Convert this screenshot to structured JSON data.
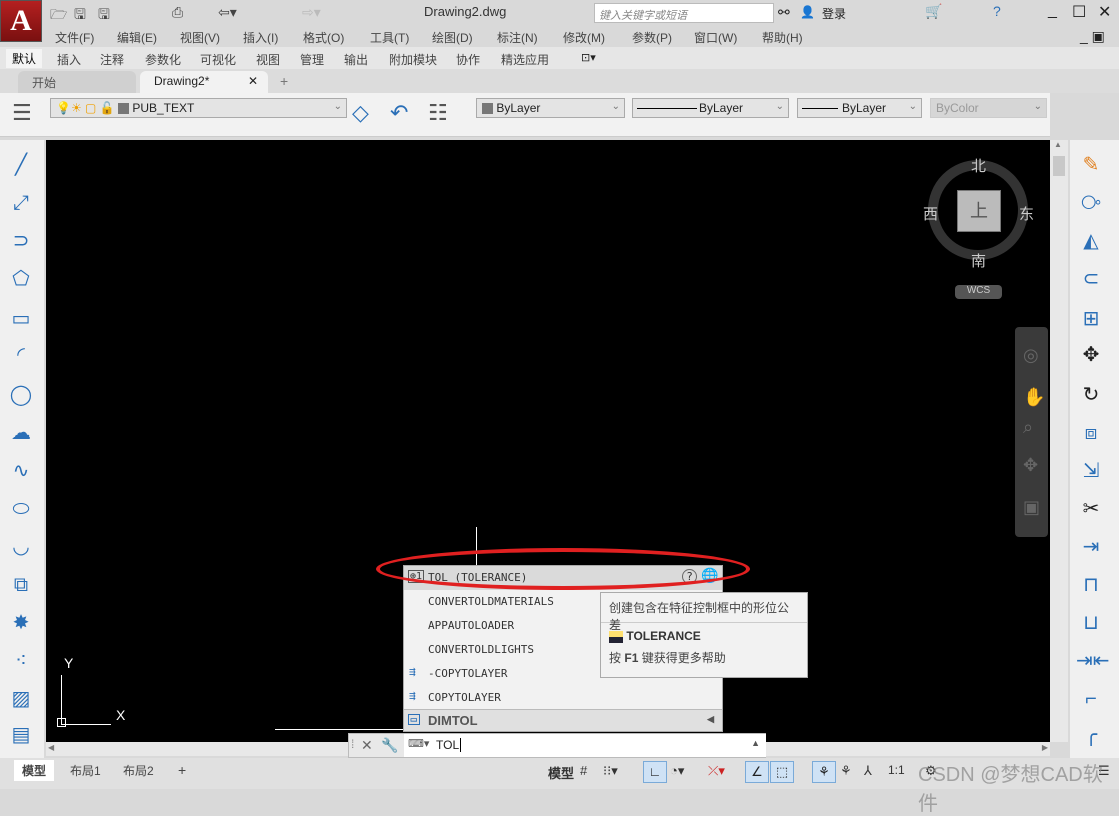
{
  "app": {
    "logo_letter": "A",
    "title": "Drawing2.dwg",
    "search_placeholder": "键入关键字或短语",
    "login": "登录"
  },
  "menu": [
    "文件(F)",
    "编辑(E)",
    "视图(V)",
    "插入(I)",
    "格式(O)",
    "工具(T)",
    "绘图(D)",
    "标注(N)",
    "修改(M)",
    "参数(P)",
    "窗口(W)",
    "帮助(H)"
  ],
  "ribbon_tabs": [
    "默认",
    "插入",
    "注释",
    "参数化",
    "可视化",
    "视图",
    "管理",
    "输出",
    "附加模块",
    "协作",
    "精选应用"
  ],
  "file_tabs": [
    "开始",
    "Drawing2*"
  ],
  "toolbar": {
    "layer": "PUB_TEXT",
    "color": "ByLayer",
    "linetype": "ByLayer",
    "lineweight": "ByLayer",
    "plotstyle": "ByColor"
  },
  "viewcube": {
    "north": "北",
    "south": "南",
    "east": "东",
    "west": "西",
    "top": "上",
    "wcs": "WCS"
  },
  "ucs": {
    "x": "X",
    "y": "Y"
  },
  "autocomplete": {
    "selected": "TOL (TOLERANCE)",
    "items": [
      "CONVERTOLDMATERIALS",
      "APPAUTOLOADER",
      "CONVERTOLDLIGHTS",
      "-COPYTOLAYER",
      "COPYTOLAYER"
    ],
    "group": "DIMTOL"
  },
  "tooltip": {
    "description": "创建包含在特征控制框中的形位公差",
    "command": "TOLERANCE",
    "help_prefix": "按",
    "help_key": "F1",
    "help_suffix": "键获得更多帮助"
  },
  "command_line": {
    "value": "TOL"
  },
  "layout_tabs": [
    "模型",
    "布局1",
    "布局2"
  ],
  "status": {
    "model": "模型",
    "scale": "1:1"
  },
  "watermark": "CSDN @梦想CAD软件",
  "colors": {
    "highlight": "#e02020",
    "canvas": "#000000",
    "accent": "#2a6fb7"
  }
}
